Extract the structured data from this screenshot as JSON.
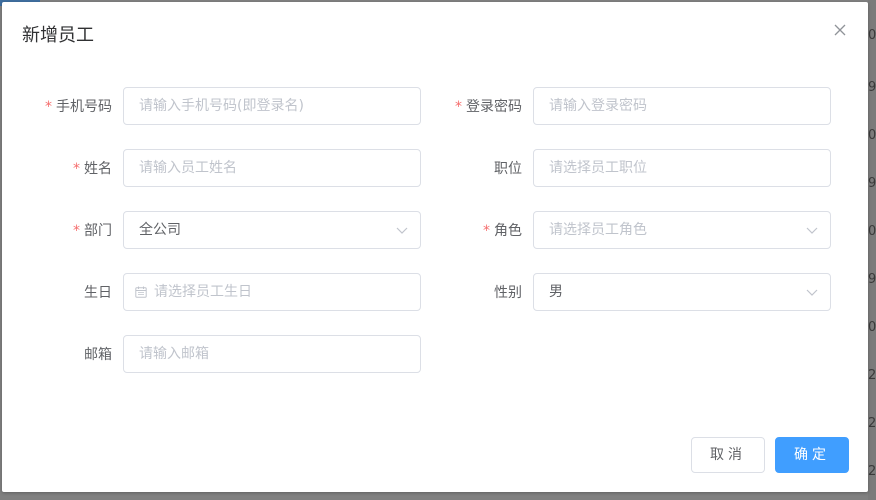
{
  "background": {
    "right_edge_digits": [
      "0",
      "9",
      "0",
      "9",
      "0",
      "9",
      "0",
      "2",
      "2",
      "2"
    ]
  },
  "dialog": {
    "title": "新增员工",
    "close_icon": "close-icon"
  },
  "form": {
    "phone": {
      "label": "手机号码",
      "required": true,
      "placeholder": "请输入手机号码(即登录名)"
    },
    "password": {
      "label": "登录密码",
      "required": true,
      "placeholder": "请输入登录密码"
    },
    "name": {
      "label": "姓名",
      "required": true,
      "placeholder": "请输入员工姓名"
    },
    "position": {
      "label": "职位",
      "required": false,
      "placeholder": "请选择员工职位"
    },
    "department": {
      "label": "部门",
      "required": true,
      "value": "全公司"
    },
    "role": {
      "label": "角色",
      "required": true,
      "placeholder": "请选择员工角色"
    },
    "birthday": {
      "label": "生日",
      "required": false,
      "placeholder": "请选择员工生日",
      "icon": "calendar-icon"
    },
    "gender": {
      "label": "性别",
      "required": false,
      "value": "男"
    },
    "email": {
      "label": "邮箱",
      "required": false,
      "placeholder": "请输入邮箱"
    },
    "required_mark": "*"
  },
  "footer": {
    "cancel_label": "取消",
    "confirm_label": "确定"
  },
  "colors": {
    "primary": "#409eff",
    "required": "#f56c6c",
    "placeholder": "#c0c4cc",
    "text": "#606266"
  }
}
